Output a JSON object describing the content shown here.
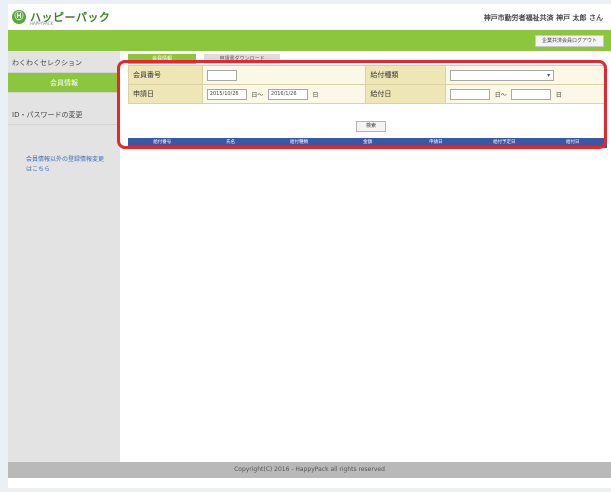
{
  "header": {
    "logo_mark": "Ⓗ",
    "logo_text": "ハッピーパック",
    "logo_sub": "HAPPYPACK",
    "user_info": "神戸市勤労者福祉共済 神戸 太郎 さん",
    "top_button": "企業共済会員ログアウト"
  },
  "sidebar": {
    "items": [
      {
        "label": "わくわくセレクション"
      },
      {
        "label": "会員情報"
      },
      {
        "label": "ID・パスワードの変更"
      }
    ],
    "link_text": "会員情報以外の登録情報変更はこちら"
  },
  "tabs": [
    {
      "label": "会員情報"
    },
    {
      "label": "申請書ダウンロード"
    }
  ],
  "form": {
    "member_no_label": "会員番号",
    "member_no_value": "",
    "benefit_type_label": "給付種類",
    "benefit_type_value": "",
    "apply_date_label": "申請日",
    "apply_from": "2015/10/26",
    "apply_to": "2016/1/26",
    "range_sep": "日～",
    "day_suffix": "日",
    "pay_date_label": "給付日",
    "pay_from": "",
    "pay_to": ""
  },
  "search_button": "検索",
  "results_columns": [
    "給付番号",
    "氏名",
    "給付種類",
    "金額",
    "申請日",
    "給付予定日",
    "給付日"
  ],
  "footer": {
    "copyright": "Copyright(C) 2016 - HappyPack all rights reserved"
  }
}
